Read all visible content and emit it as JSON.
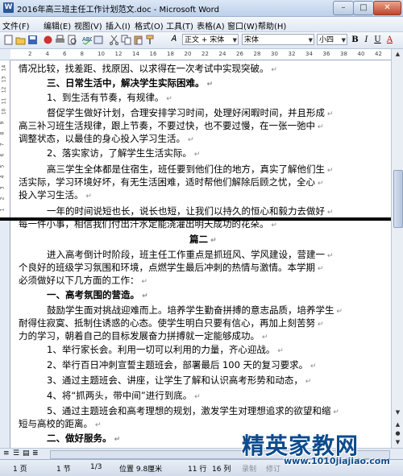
{
  "window": {
    "title": "2016年高三班主任工作计划范文.doc - Microsoft Word",
    "app_icon": "W"
  },
  "menu": [
    "文件(F)",
    "编辑(E)",
    "视图(V)",
    "插入(I)",
    "格式(O)",
    "工具(T)",
    "表格(A)",
    "窗口(W)",
    "帮助(H)"
  ],
  "toolbar": {
    "style": "正文 + 宋体",
    "font": "宋体",
    "size": "小四",
    "bold": "B",
    "italic": "I",
    "underline": "U",
    "fontcolor": "A"
  },
  "ruler_numbers": [
    "2",
    "4",
    "6",
    "8",
    "10",
    "12",
    "14",
    "16",
    "18",
    "20",
    "22",
    "24",
    "26",
    "28",
    "30",
    "32",
    "34",
    "36",
    "38",
    "40",
    "42"
  ],
  "vruler_numbers": [
    "14",
    "13",
    "12",
    "11",
    "10",
    "9",
    "8",
    "7",
    "6",
    "5",
    "4",
    "3",
    "2",
    "1"
  ],
  "doc_top": [
    "情况比较，找差距、找原因、以求得在一次考试中实现突破。",
    "三、日常生活中，解决学生实际困难。",
    "1、到生活有节奏，有规律。",
    "督促学生做好计划，合理安排学习时间，处理好闲暇时间，并且形成",
    "高三补习班生活规律，跟上节奏，不要过快，也不要过慢，在一张一弛中",
    "调整状态，以最佳的身心投入学习生活。",
    "2、落实家访，了解学生生活实际。",
    "高三学生全体都是住宿生，班任要到他们住的地方，真实了解他们生",
    "活实际，学习环境好坏，有无生活困难，适时帮他们解除后顾之忧，全心",
    "投入学习生活。"
  ],
  "doc_bottom": [
    "一年的时间说短也长，说长也短，让我们以持久的恒心和毅力去做好",
    "每一件小事，相信我们付出汗水定能浇灌出明天成功的花朵。",
    "篇二",
    "进入高考倒计时阶段，班主任工作重点是抓班风、学风建设，营建一",
    "个良好的班级学习氛围和环境，点燃学生最后冲刺的热情与激情。本学期",
    "必须做好以下几方面的工作：",
    "一、高考氛围的营造。",
    "鼓励学生面对挑战迎难而上。培养学生勤奋拼搏的意志品质，培养学生",
    "耐得住寂寞、抵制住诱惑的心态。使学生明白只要有信心，再加上刻苦努",
    "力的学习，朝着自己的目标发展奋力拼搏就一定能够成功。",
    "1、举行家长会。利用一切可以利用的力量，齐心迎战。",
    "2、举行百日冲刺宣誓主题班会，部署最后 100 天的复习要求。",
    "3、通过主题班会、讲座，让学生了解和认识高考形势和动态，",
    "4、将“抓两头，带中间”进行到底。",
    "5、通过主题班会和高考理想的规划，激发学生对理想追求的欲望和缩",
    "短与高校的距离。",
    "二、做好服务。",
    "1、督促学生做好计划，合理安排学习时间，适当参加"
  ],
  "status": {
    "page": "1 页",
    "section": "1 节",
    "pages": "1/3",
    "position": "位置 9.8厘米",
    "row": "11 行",
    "col": "16 列",
    "rec": "录制",
    "trk": "修订"
  },
  "watermark": {
    "title": "精英家教网",
    "url": "www.1010jiajiao.com"
  }
}
